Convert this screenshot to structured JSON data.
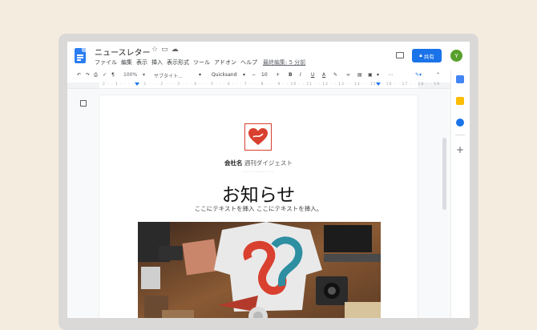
{
  "document": {
    "title": "ニュースレター",
    "title_icons": [
      "star-icon",
      "folder-icon",
      "cloud-icon"
    ]
  },
  "menu": {
    "items": [
      "ファイル",
      "編集",
      "表示",
      "挿入",
      "表示形式",
      "ツール",
      "アドオン",
      "ヘルプ"
    ],
    "last_edit": "最終編集: 5 分前"
  },
  "share": {
    "label": "共有"
  },
  "avatar": {
    "initial": "Y",
    "color": "#57a02c"
  },
  "toolbar": {
    "zoom": "100%",
    "style": "サブタイト...",
    "font": "Quicksand",
    "font_size": "10",
    "minus": "−",
    "plus": "+",
    "bold": "B",
    "italic": "I",
    "underline": "U",
    "text_color": "A",
    "more": "⋯"
  },
  "ruler": {
    "ticks": "2 · · 1 · · ·  · · · 1 · · · 2 · · · 3 · · · 4 · · · 5 · · · 6 · · · 7 · · · 8 · · · 9 · · 10 · · 11 · · 12 · · 13 · · 14 · · 15 · · 16 · · 17 · · 18 · · 19"
  },
  "side_panel": {
    "add": "+"
  },
  "page": {
    "company_name": "会社名",
    "digest": "週刊ダイジェスト",
    "divider": "···············",
    "heading": "お知らせ",
    "subtext": "ここにテキストを挿入 ここにテキストを挿入。"
  },
  "colors": {
    "accent": "#1a73e8",
    "logo_red": "#d9402f",
    "background": "#f5ece0"
  }
}
